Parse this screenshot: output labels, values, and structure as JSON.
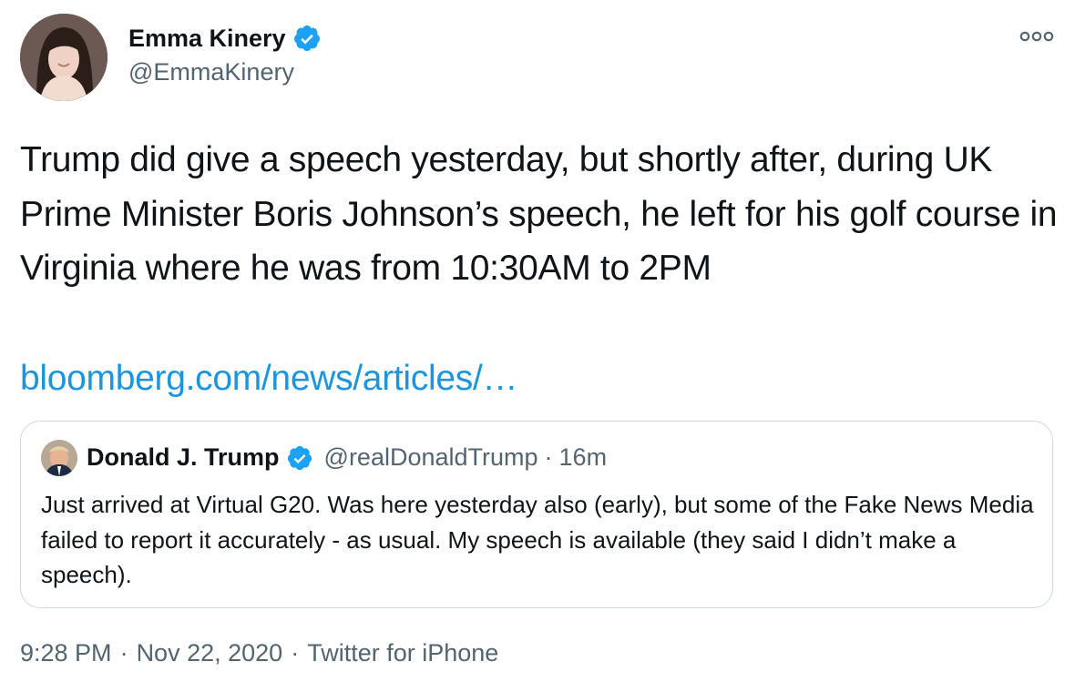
{
  "author": {
    "name": "Emma Kinery",
    "handle": "@EmmaKinery",
    "verified_icon": "verified-badge-icon"
  },
  "tweet": {
    "text": "Trump did give a speech yesterday, but shortly after, during UK Prime Minister Boris Johnson’s speech, he left for his golf course in Virginia where he was from 10:30AM to 2PM",
    "link_text": "bloomberg.com/news/articles/…"
  },
  "quoted_tweet": {
    "name": "Donald J. Trump",
    "handle": "@realDonaldTrump",
    "separator": "·",
    "time": "16m",
    "text": "Just arrived at Virtual G20. Was here yesterday also (early), but some of the Fake News Media failed to report it accurately - as usual. My speech is available (they said I didn’t make a speech)."
  },
  "meta": {
    "time": "9:28 PM",
    "separator": "·",
    "date": "Nov 22, 2020",
    "source": "Twitter for iPhone"
  },
  "colors": {
    "link": "#1b95e0",
    "verified": "#1da1f2",
    "secondary_text": "#536471",
    "border": "#cfd9de"
  }
}
